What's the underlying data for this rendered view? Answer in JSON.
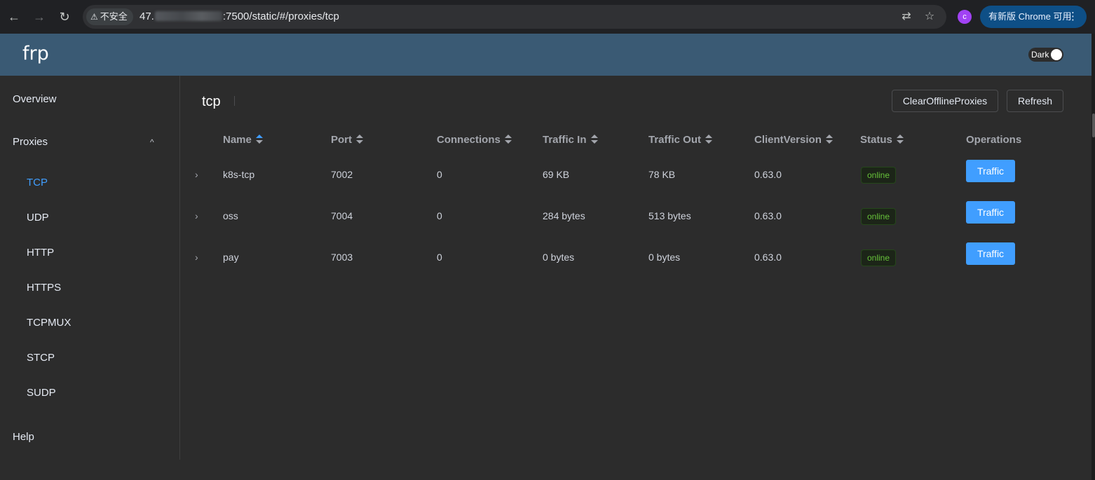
{
  "browser": {
    "insecure_label": "不安全",
    "url_prefix": "47.",
    "url_suffix": ":7500/static/#/proxies/tcp",
    "profile_initial": "c",
    "update_label": "有新版 Chrome 可用"
  },
  "app": {
    "brand": "frp",
    "dark_toggle_label": "Dark"
  },
  "sidebar": {
    "overview": "Overview",
    "proxies": "Proxies",
    "proxy_types": [
      "TCP",
      "UDP",
      "HTTP",
      "HTTPS",
      "TCPMUX",
      "STCP",
      "SUDP"
    ],
    "active_type": "TCP",
    "help": "Help"
  },
  "page": {
    "title": "tcp",
    "clear_button": "ClearOfflineProxies",
    "refresh_button": "Refresh"
  },
  "table": {
    "headers": [
      "Name",
      "Port",
      "Connections",
      "Traffic In",
      "Traffic Out",
      "ClientVersion",
      "Status",
      "Operations"
    ],
    "rows": [
      {
        "name": "k8s-tcp",
        "port": "7002",
        "connections": "0",
        "traffic_in": "69 KB",
        "traffic_out": "78 KB",
        "client_version": "0.63.0",
        "status": "online",
        "operation": "Traffic"
      },
      {
        "name": "oss",
        "port": "7004",
        "connections": "0",
        "traffic_in": "284 bytes",
        "traffic_out": "513 bytes",
        "client_version": "0.63.0",
        "status": "online",
        "operation": "Traffic"
      },
      {
        "name": "pay",
        "port": "7003",
        "connections": "0",
        "traffic_in": "0 bytes",
        "traffic_out": "0 bytes",
        "client_version": "0.63.0",
        "status": "online",
        "operation": "Traffic"
      }
    ]
  },
  "colors": {
    "header_bg": "#3a5a74",
    "accent": "#409eff",
    "status_online": "#67c23a",
    "page_bg": "#2c2c2c"
  }
}
